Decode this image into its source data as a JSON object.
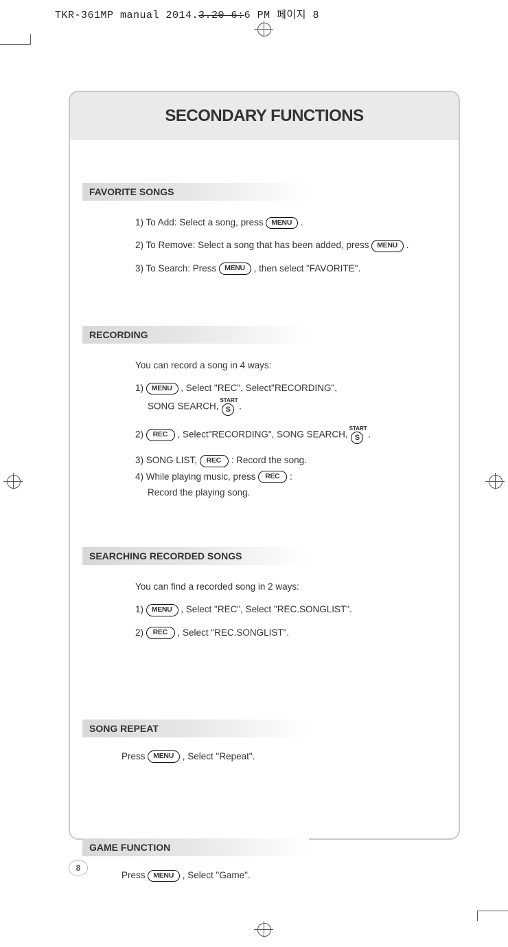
{
  "header": {
    "text_prefix": "TKR-361MP manual  2014.",
    "text_strike": "3.20  6:",
    "text_suffix": "6 PM  페이지 8"
  },
  "title": "SECONDARY FUNCTIONS",
  "buttons": {
    "menu": "MENU",
    "rec": "REC",
    "start_label": "START",
    "start_s": "S"
  },
  "sections": {
    "favorite": {
      "heading": "FAVORITE SONGS",
      "l1a": "1) To Add: Select a song, press",
      "l1b": ".",
      "l2a": "2) To Remove: Select a song that has been added, press",
      "l2b": ".",
      "l3a": "3) To Search: Press",
      "l3b": ", then select \"FAVORITE\"."
    },
    "recording": {
      "heading": "RECORDING",
      "intro": "You can record a song in 4 ways:",
      "l1a": "1)",
      "l1b": ", Select \"REC\", Select\"RECORDING\",",
      "l1c": "SONG SEARCH,",
      "l1d": ".",
      "l2a": "2)",
      "l2b": ", Select\"RECORDING\", SONG SEARCH,",
      "l2c": ".",
      "l3a": "3) SONG LIST,",
      "l3b": ": Record the song.",
      "l4a": "4) While playing music, press",
      "l4b": ":",
      "l4c": "Record the playing song."
    },
    "searching": {
      "heading": "SEARCHING RECORDED SONGS",
      "intro": "You can find a recorded song in 2 ways:",
      "l1a": "1)",
      "l1b": ", Select \"REC\", Select \"REC.SONGLIST\".",
      "l2a": "2)",
      "l2b": ", Select \"REC.SONGLIST\"."
    },
    "repeat": {
      "heading": "SONG REPEAT",
      "l1a": "Press",
      "l1b": ", Select \"Repeat\"."
    },
    "game": {
      "heading": "GAME FUNCTION",
      "l1a": "Press",
      "l1b": ", Select \"Game\"."
    }
  },
  "page_number": "8"
}
